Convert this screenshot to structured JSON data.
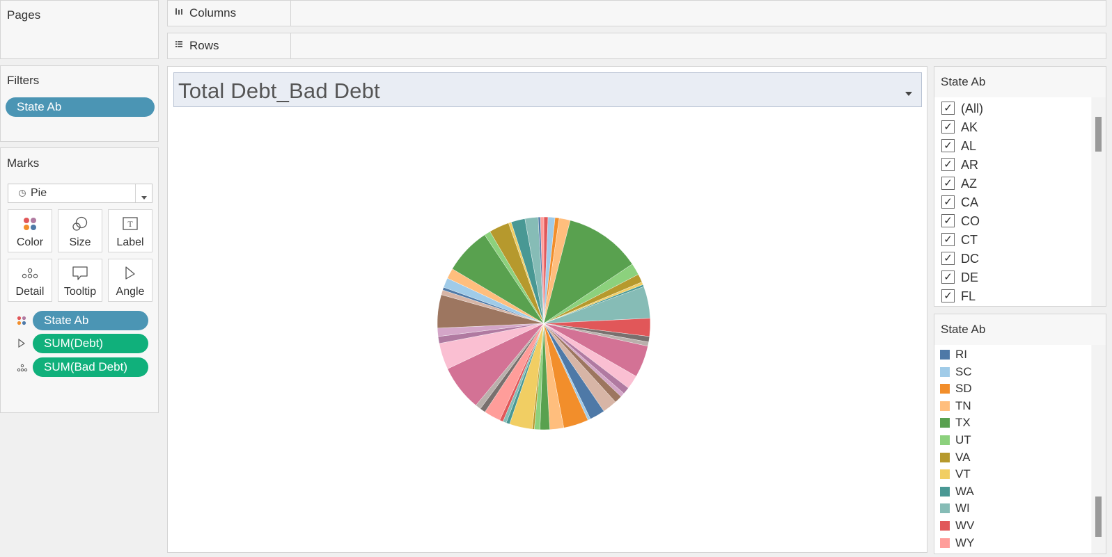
{
  "pages": {
    "title": "Pages"
  },
  "shelves": {
    "columns_label": "Columns",
    "rows_label": "Rows"
  },
  "filters": {
    "title": "Filters",
    "pill": "State Ab"
  },
  "marks": {
    "title": "Marks",
    "mark_type": "Pie",
    "buttons": [
      "Color",
      "Size",
      "Label",
      "Detail",
      "Tooltip",
      "Angle"
    ],
    "fields": [
      "State Ab",
      "SUM(Debt)",
      "SUM(Bad Debt)"
    ]
  },
  "view": {
    "title": "Total Debt_Bad Debt"
  },
  "filter_card": {
    "title": "State Ab",
    "items": [
      "(All)",
      "AK",
      "AL",
      "AR",
      "AZ",
      "CA",
      "CO",
      "CT",
      "DC",
      "DE",
      "FL"
    ],
    "checked": true
  },
  "legend": {
    "title": "State Ab",
    "items": [
      {
        "label": "RI",
        "color": "#4e79a7"
      },
      {
        "label": "SC",
        "color": "#a0cbe8"
      },
      {
        "label": "SD",
        "color": "#f28e2b"
      },
      {
        "label": "TN",
        "color": "#ffbe7d"
      },
      {
        "label": "TX",
        "color": "#59a14f"
      },
      {
        "label": "UT",
        "color": "#8cd17d"
      },
      {
        "label": "VA",
        "color": "#b6992d"
      },
      {
        "label": "VT",
        "color": "#f1ce63"
      },
      {
        "label": "WA",
        "color": "#499894"
      },
      {
        "label": "WI",
        "color": "#86bcb6"
      },
      {
        "label": "WV",
        "color": "#e15759"
      },
      {
        "label": "WY",
        "color": "#ff9d9a"
      }
    ]
  },
  "chart_data": {
    "type": "pie",
    "start_angle_deg": 0,
    "slices": [
      {
        "color": "#e15759",
        "value": 0.6
      },
      {
        "color": "#a0cbe8",
        "value": 1.0
      },
      {
        "color": "#f28e2b",
        "value": 0.6
      },
      {
        "color": "#ffbe7d",
        "value": 1.6
      },
      {
        "color": "#59a14f",
        "value": 11.0
      },
      {
        "color": "#8cd17d",
        "value": 1.7
      },
      {
        "color": "#b6992d",
        "value": 1.2
      },
      {
        "color": "#f1ce63",
        "value": 0.4
      },
      {
        "color": "#499894",
        "value": 0.3
      },
      {
        "color": "#86bcb6",
        "value": 4.6
      },
      {
        "color": "#e15759",
        "value": 2.6
      },
      {
        "color": "#79706e",
        "value": 0.8
      },
      {
        "color": "#bab0ac",
        "value": 0.6
      },
      {
        "color": "#d37295",
        "value": 4.6
      },
      {
        "color": "#fabfd2",
        "value": 2.0
      },
      {
        "color": "#b07aa1",
        "value": 1.0
      },
      {
        "color": "#d4a6c8",
        "value": 0.6
      },
      {
        "color": "#9d7660",
        "value": 1.1
      },
      {
        "color": "#d7b5a6",
        "value": 2.1
      },
      {
        "color": "#4e79a7",
        "value": 2.2
      },
      {
        "color": "#a0cbe8",
        "value": 0.4
      },
      {
        "color": "#f28e2b",
        "value": 3.6
      },
      {
        "color": "#ffbe7d",
        "value": 2.0
      },
      {
        "color": "#59a14f",
        "value": 1.4
      },
      {
        "color": "#8cd17d",
        "value": 0.8
      },
      {
        "color": "#b6992d",
        "value": 0.3
      },
      {
        "color": "#f1ce63",
        "value": 3.3
      },
      {
        "color": "#499894",
        "value": 0.5
      },
      {
        "color": "#86bcb6",
        "value": 0.5
      },
      {
        "color": "#e15759",
        "value": 0.5
      },
      {
        "color": "#ff9d9a",
        "value": 2.4
      },
      {
        "color": "#79706e",
        "value": 0.8
      },
      {
        "color": "#bab0ac",
        "value": 0.8
      },
      {
        "color": "#d37295",
        "value": 6.6
      },
      {
        "color": "#fabfd2",
        "value": 3.8
      },
      {
        "color": "#b07aa1",
        "value": 1.0
      },
      {
        "color": "#d4a6c8",
        "value": 1.2
      },
      {
        "color": "#9d7660",
        "value": 4.8
      },
      {
        "color": "#d7b5a6",
        "value": 0.7
      },
      {
        "color": "#4e79a7",
        "value": 0.4
      },
      {
        "color": "#a0cbe8",
        "value": 1.4
      },
      {
        "color": "#ffbe7d",
        "value": 1.5
      },
      {
        "color": "#59a14f",
        "value": 6.7
      },
      {
        "color": "#8cd17d",
        "value": 0.9
      },
      {
        "color": "#b6992d",
        "value": 2.9
      },
      {
        "color": "#f1ce63",
        "value": 0.4
      },
      {
        "color": "#499894",
        "value": 2.0
      },
      {
        "color": "#86bcb6",
        "value": 1.9
      },
      {
        "color": "#4e79a7",
        "value": 0.3
      },
      {
        "color": "#ff9d9a",
        "value": 0.5
      }
    ]
  }
}
